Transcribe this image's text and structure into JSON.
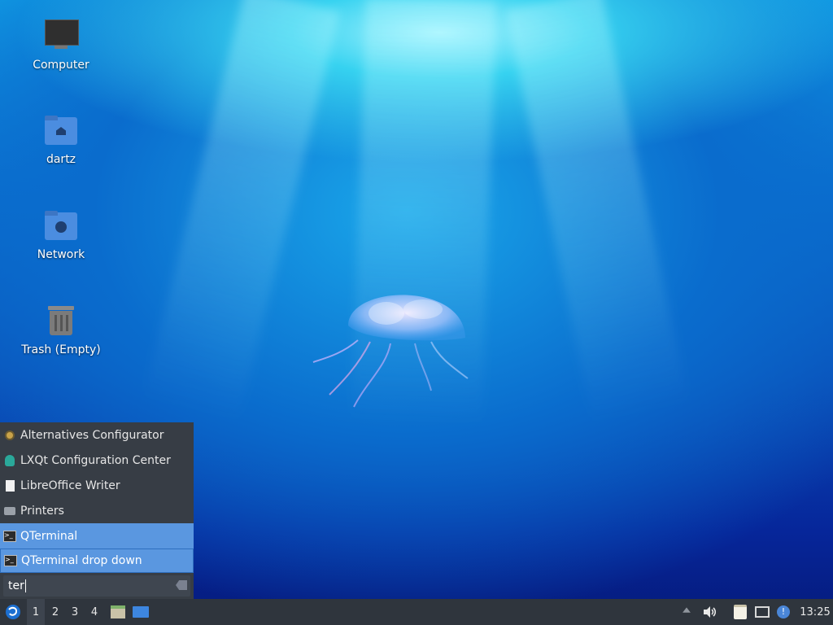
{
  "desktop": {
    "icons": [
      {
        "label": "Computer",
        "icon": "computer-icon"
      },
      {
        "label": "dartz",
        "icon": "home-folder-icon"
      },
      {
        "label": "Network",
        "icon": "network-folder-icon"
      },
      {
        "label": "Trash (Empty)",
        "icon": "trash-icon"
      }
    ]
  },
  "menu": {
    "items": [
      {
        "label": "Alternatives Configurator",
        "icon": "gear-icon",
        "selected": false
      },
      {
        "label": "LXQt Configuration Center",
        "icon": "lxqt-config-icon",
        "selected": false
      },
      {
        "label": "LibreOffice Writer",
        "icon": "document-icon",
        "selected": false
      },
      {
        "label": "Printers",
        "icon": "printer-icon",
        "selected": false
      },
      {
        "label": "QTerminal",
        "icon": "terminal-icon",
        "selected": true
      },
      {
        "label": "QTerminal drop down",
        "icon": "terminal-icon",
        "selected": true
      }
    ],
    "search_value": "ter"
  },
  "taskbar": {
    "workspaces": [
      "1",
      "2",
      "3",
      "4"
    ],
    "active_workspace": "1",
    "clock": "13:25"
  },
  "colors": {
    "menu_bg": "#373d45",
    "selection": "#5a97e0",
    "taskbar_bg": "#2f353d"
  }
}
